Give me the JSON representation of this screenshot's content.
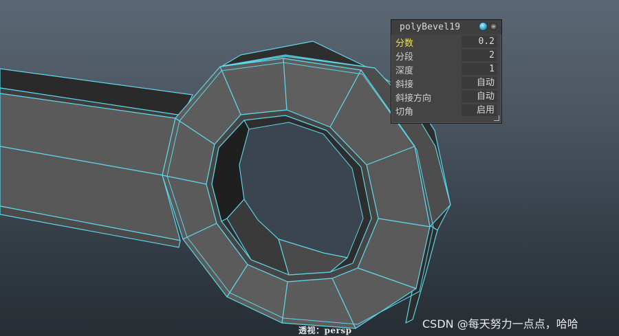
{
  "hud": {
    "title": "polyBevel19",
    "rows": [
      {
        "label": "分数",
        "value": "0.2"
      },
      {
        "label": "分段",
        "value": "2"
      },
      {
        "label": "深度",
        "value": "1"
      },
      {
        "label": "斜接",
        "value": "自动"
      },
      {
        "label": "斜接方向",
        "value": "自动"
      },
      {
        "label": "切角",
        "value": "启用"
      }
    ]
  },
  "viewport": {
    "camera_label": "透视：persp"
  },
  "watermark": "CSDN @每天努力一点点，哈哈",
  "colors": {
    "wireframe": "#5fd6ea",
    "active_label": "#f1e23a"
  }
}
